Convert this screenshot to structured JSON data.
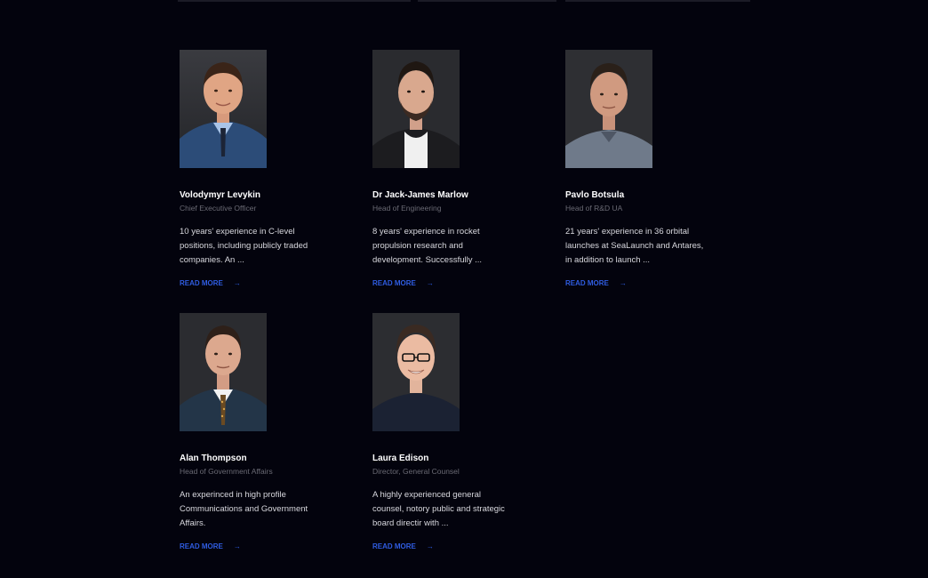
{
  "team": [
    {
      "name": "Volodymyr Levykin",
      "role": "Chief Executive Officer",
      "bio": "10 years' experience in C-level positions, including publicly traded companies. An ...",
      "cta": "READ MORE"
    },
    {
      "name": "Dr Jack-James Marlow",
      "role": "Head of Engineering",
      "bio": "8 years' experience in rocket propulsion research and development. Successfully ...",
      "cta": "READ MORE"
    },
    {
      "name": "Pavlo Botsula",
      "role": "Head of R&D UA",
      "bio": "21 years' experience in 36 orbital launches at SeaLaunch and Antares, in addition to launch ...",
      "cta": "READ MORE"
    },
    {
      "name": "Alan Thompson",
      "role": "Head of Government Affairs",
      "bio": "An experinced in high profile Communications and Government Affairs.",
      "cta": "READ MORE"
    },
    {
      "name": "Laura Edison",
      "role": "Director, General Counsel",
      "bio": "A highly experienced general counsel, notory public and strategic board directir with ...",
      "cta": "READ MORE"
    }
  ],
  "icons": {
    "arrow": "arrow-right-icon"
  },
  "colors": {
    "background": "#03030d",
    "accent": "#2f5ce0",
    "name": "#ffffff",
    "role": "#6a6a74",
    "bio": "#d8d8de"
  }
}
